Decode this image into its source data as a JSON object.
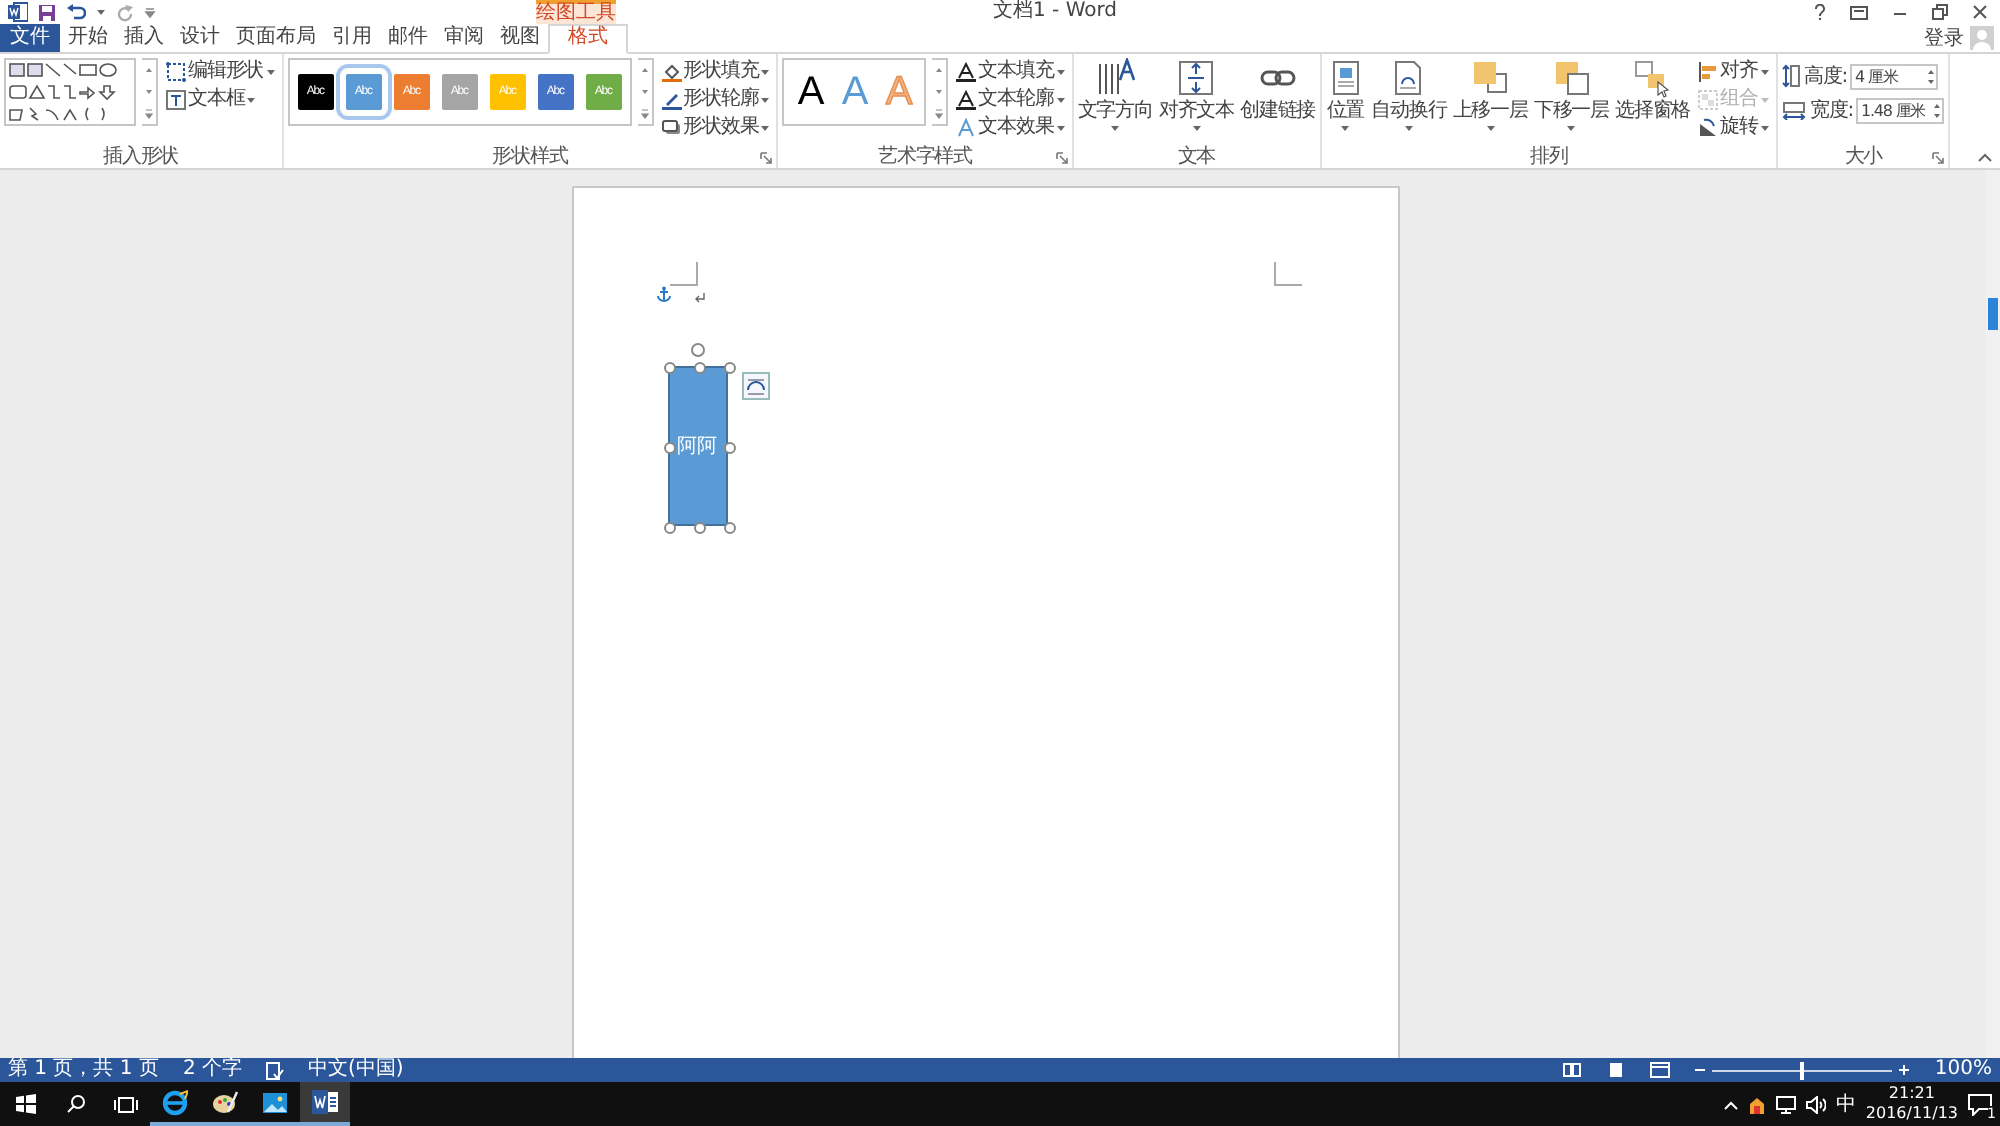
{
  "window": {
    "title": "文档1 - Word",
    "contextual_tab": "绘图工具",
    "sign_in": "登录"
  },
  "tabs": [
    {
      "label": "文件",
      "kind": "file",
      "selected": false
    },
    {
      "label": "开始",
      "kind": "tab",
      "selected": false
    },
    {
      "label": "插入",
      "kind": "tab",
      "selected": false
    },
    {
      "label": "设计",
      "kind": "tab",
      "selected": false
    },
    {
      "label": "页面布局",
      "kind": "tab",
      "selected": false
    },
    {
      "label": "引用",
      "kind": "tab",
      "selected": false
    },
    {
      "label": "邮件",
      "kind": "tab",
      "selected": false
    },
    {
      "label": "审阅",
      "kind": "tab",
      "selected": false
    },
    {
      "label": "视图",
      "kind": "tab",
      "selected": false
    },
    {
      "label": "格式",
      "kind": "contextual",
      "selected": true
    }
  ],
  "ribbon": {
    "insert_shapes": {
      "label": "插入形状",
      "commands": [
        {
          "label": "编辑形状",
          "menu": true
        },
        {
          "label": "文本框",
          "menu": true
        }
      ]
    },
    "shape_styles": {
      "label": "形状样式",
      "swatches": [
        {
          "label": "Abc",
          "color": "#000000",
          "selected": false
        },
        {
          "label": "Abc",
          "color": "#5b9bd5",
          "selected": true
        },
        {
          "label": "Abc",
          "color": "#ed7d31",
          "selected": false
        },
        {
          "label": "Abc",
          "color": "#a5a5a5",
          "selected": false
        },
        {
          "label": "Abc",
          "color": "#ffc000",
          "selected": false
        },
        {
          "label": "Abc",
          "color": "#4472c4",
          "selected": false
        },
        {
          "label": "Abc",
          "color": "#70ad47",
          "selected": false
        }
      ],
      "commands": [
        {
          "label": "形状填充",
          "menu": true
        },
        {
          "label": "形状轮廓",
          "menu": true
        },
        {
          "label": "形状效果",
          "menu": true
        }
      ]
    },
    "wordart_styles": {
      "label": "艺术字样式",
      "samples": [
        {
          "label": "A",
          "kind": "fill",
          "color": "#000000"
        },
        {
          "label": "A",
          "kind": "fill",
          "color": "#5b9bd5"
        },
        {
          "label": "A",
          "kind": "outline",
          "color": "#f4b183"
        }
      ],
      "commands": [
        {
          "label": "文本填充",
          "menu": true
        },
        {
          "label": "文本轮廓",
          "menu": true
        },
        {
          "label": "文本效果",
          "menu": true
        }
      ]
    },
    "text": {
      "label": "文本",
      "commands": [
        {
          "label": "文字方向",
          "menu": true
        },
        {
          "label": "对齐文本",
          "menu": true
        },
        {
          "label": "创建链接",
          "menu": false
        }
      ]
    },
    "arrange": {
      "label": "排列",
      "commands": [
        {
          "label": "位置",
          "menu": true
        },
        {
          "label": "自动换行",
          "menu": true
        },
        {
          "label": "上移一层",
          "menu": true
        },
        {
          "label": "下移一层",
          "menu": true
        },
        {
          "label": "选择窗格",
          "menu": false
        }
      ],
      "small_commands": [
        {
          "label": "对齐",
          "menu": true,
          "disabled": false
        },
        {
          "label": "组合",
          "menu": true,
          "disabled": true
        },
        {
          "label": "旋转",
          "menu": true,
          "disabled": false
        }
      ]
    },
    "size": {
      "label": "大小",
      "fields": [
        {
          "label": "高度:",
          "value": "4 厘米"
        },
        {
          "label": "宽度:",
          "value": "1.48 厘米"
        }
      ]
    }
  },
  "document": {
    "shape_text": "阿阿"
  },
  "status_bar": {
    "items": [
      "第 1 页，共 1 页",
      "2 个字",
      "中文(中国)"
    ],
    "zoom": "100%",
    "zoom_slider": {
      "level": 0.5
    }
  },
  "taskbar": {
    "apps": [
      {
        "kind": "browser",
        "selected": false
      },
      {
        "kind": "paint",
        "selected": false
      },
      {
        "kind": "photos",
        "selected": false
      },
      {
        "kind": "word",
        "selected": true
      }
    ],
    "ime": "中",
    "time": "21:21",
    "date": "2016/11/13",
    "notifications": "1"
  }
}
